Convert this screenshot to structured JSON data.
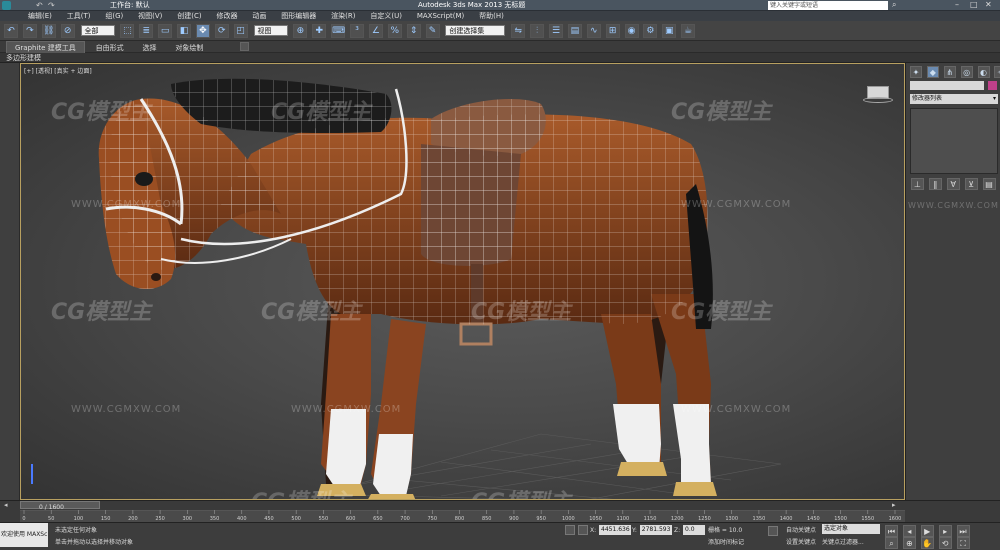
{
  "title": "Autodesk 3ds Max  2013        无标题",
  "workspace_label": "工作台: 默认",
  "search_placeholder": "键入关键字或短语",
  "menu": [
    "编辑(E)",
    "工具(T)",
    "组(G)",
    "视图(V)",
    "创建(C)",
    "修改器",
    "动画",
    "图形编辑器",
    "渲染(R)",
    "自定义(U)",
    "MAXScript(M)",
    "帮助(H)"
  ],
  "toolbar": {
    "selection_filter": "全部",
    "ref_coord": "视图",
    "named_selection": "创建选择集",
    "icons": [
      "undo-icon",
      "redo-icon",
      "link-icon",
      "unlink-icon",
      "bind-icon",
      "select-icon",
      "select-by-name-icon",
      "region-select-icon",
      "window-crossing-icon",
      "move-icon",
      "rotate-icon",
      "scale-icon",
      "pivot-icon",
      "select-manipulate-icon",
      "keyboard-shortcut-icon",
      "snap-icon",
      "angle-snap-icon",
      "percent-snap-icon",
      "spinner-snap-icon",
      "edit-named-sel-icon",
      "mirror-icon",
      "align-icon",
      "layer-icon",
      "ribbon-icon",
      "curve-editor-icon",
      "schematic-icon",
      "material-editor-icon",
      "render-setup-icon",
      "rendered-frame-icon",
      "render-icon"
    ]
  },
  "ribbon": {
    "tabs": [
      "Graphite 建模工具",
      "自由形式",
      "选择",
      "对象绘制"
    ],
    "active_tab": "Graphite 建模工具",
    "sub_label": "多边形建模"
  },
  "viewport": {
    "label_parts": [
      "+",
      "透视",
      "真实 + 边面"
    ],
    "watermark_main": "CG模型主",
    "watermark_url": "WWW.CGMXW.COM"
  },
  "command_panel": {
    "tabs": [
      "create-tab",
      "modify-tab",
      "hierarchy-tab",
      "motion-tab",
      "display-tab",
      "utilities-tab"
    ],
    "modifier_list": "修改器列表",
    "stack_buttons": [
      "pin-stack-icon",
      "show-end-result-icon",
      "make-unique-icon",
      "remove-modifier-icon",
      "configure-sets-icon"
    ]
  },
  "timeline": {
    "frame_counter": "0 / 1600",
    "ticks": [
      "0",
      "50",
      "100",
      "150",
      "200",
      "250",
      "300",
      "350",
      "400",
      "450",
      "500",
      "550",
      "600",
      "650",
      "700",
      "750",
      "800",
      "850",
      "900",
      "950",
      "1000",
      "1050",
      "1100",
      "1150",
      "1200",
      "1250",
      "1300",
      "1350",
      "1400",
      "1450",
      "1500",
      "1550",
      "1600"
    ]
  },
  "status": {
    "maxscript_label": "欢迎使用 MAXSc",
    "selection_status": "未选定任何对象",
    "prompt": "单击并拖动以选择并移动对象",
    "x_label": "X:",
    "x_value": "4451.636",
    "y_label": "Y:",
    "y_value": "2781.593",
    "z_label": "Z:",
    "z_value": "0.0",
    "grid_label": "栅格 = 10.0",
    "add_time_tag": "添加时间标记",
    "auto_key": "自动关键点",
    "set_key": "设置关键点",
    "selected_dropdown": "选定对象",
    "key_filters": "关键点过滤器..."
  },
  "colors": {
    "viewport_border": "#b8a060",
    "accent_blue": "#9ecbff"
  }
}
